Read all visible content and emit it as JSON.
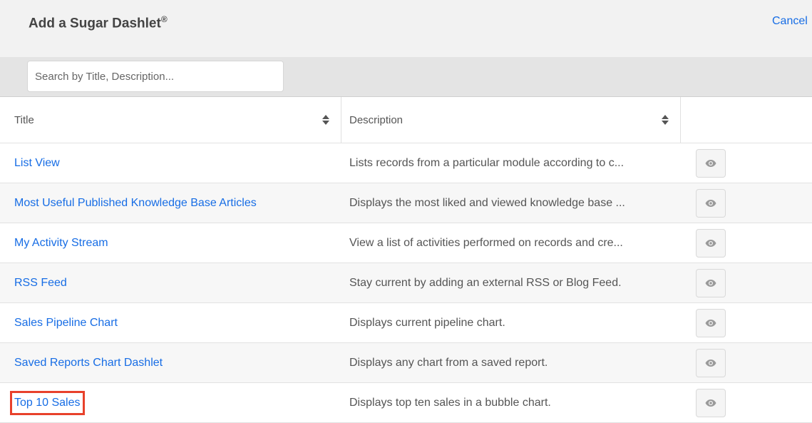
{
  "header": {
    "title": "Add a Sugar Dashlet",
    "title_mark": "®",
    "cancel_label": "Cancel"
  },
  "search": {
    "placeholder": "Search by Title, Description..."
  },
  "table": {
    "columns": [
      "Title",
      "Description"
    ],
    "rows": [
      {
        "title": "List View",
        "description": "Lists records from a particular module according to c..."
      },
      {
        "title": "Most Useful Published Knowledge Base Articles",
        "description": "Displays the most liked and viewed knowledge base ..."
      },
      {
        "title": "My Activity Stream",
        "description": "View a list of activities performed on records and cre..."
      },
      {
        "title": "RSS Feed",
        "description": "Stay current by adding an external RSS or Blog Feed."
      },
      {
        "title": "Sales Pipeline Chart",
        "description": "Displays current pipeline chart."
      },
      {
        "title": "Saved Reports Chart Dashlet",
        "description": "Displays any chart from a saved report."
      },
      {
        "title": "Top 10 Sales",
        "description": "Displays top ten sales in a bubble chart."
      }
    ]
  },
  "icons": {
    "sort": "sort-icon",
    "preview": "eye-icon"
  },
  "colors": {
    "link": "#176de5",
    "highlight": "#e8412b",
    "header_bg": "#f2f2f2",
    "search_bar_bg": "#e4e4e4"
  }
}
